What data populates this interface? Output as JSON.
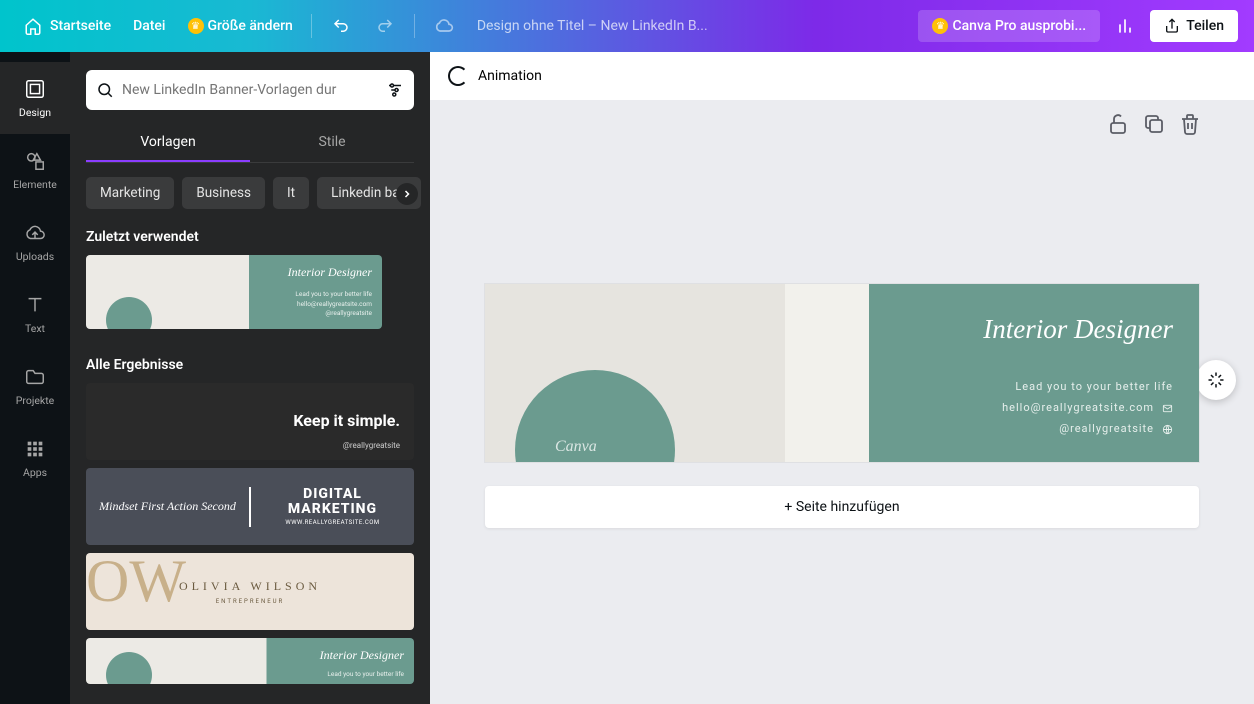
{
  "topbar": {
    "home": "Startseite",
    "file": "Datei",
    "resize": "Größe ändern",
    "title": "Design ohne Titel – New LinkedIn B...",
    "pro": "Canva Pro ausprobi...",
    "share": "Teilen"
  },
  "rail": {
    "design": "Design",
    "elemente": "Elemente",
    "uploads": "Uploads",
    "text": "Text",
    "projekte": "Projekte",
    "apps": "Apps"
  },
  "panel": {
    "search_placeholder": "New LinkedIn Banner-Vorlagen dur",
    "tabs": {
      "templates": "Vorlagen",
      "styles": "Stile"
    },
    "chips": [
      "Marketing",
      "Business",
      "It",
      "Linkedin ban"
    ],
    "recent_title": "Zuletzt verwendet",
    "all_title": "Alle Ergebnisse",
    "tpl_interior": {
      "title": "Interior Designer",
      "lines": "Lead you to your better life\nhello@reallygreatsite.com\n@reallygreatsite"
    },
    "tpl_simple": {
      "text": "Keep it simple.",
      "handle": "@reallygreatsite"
    },
    "tpl_digital": {
      "left": "Mindset First Action Second",
      "right": "DIGITAL\nMARKETING",
      "url": "WWW.REALLYGREATSITE.COM"
    },
    "tpl_olivia": {
      "name": "OLIVIA WILSON",
      "role": "ENTREPRENEUR"
    }
  },
  "context": {
    "animation": "Animation"
  },
  "canvas": {
    "watermark": "Canva",
    "title": "Interior Designer",
    "line1": "Lead you to your better life",
    "line2": "hello@reallygreatsite.com",
    "line3": "@reallygreatsite",
    "add_page": "+ Seite hinzufügen"
  }
}
